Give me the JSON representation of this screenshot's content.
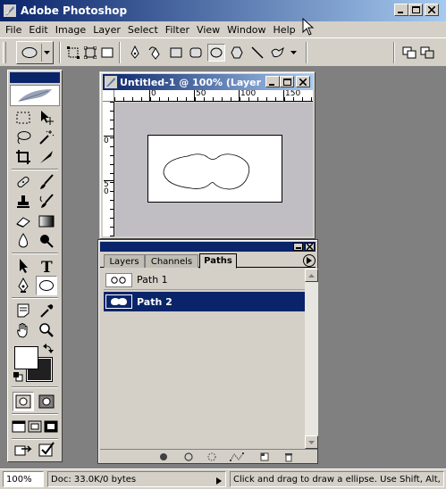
{
  "app": {
    "title": "Adobe Photoshop"
  },
  "menu": [
    "File",
    "Edit",
    "Image",
    "Layer",
    "Select",
    "Filter",
    "View",
    "Window",
    "Help"
  ],
  "document": {
    "title": "Untitled-1 @ 100% (Layer ...",
    "ruler_h": [
      "0",
      "50",
      "100",
      "150"
    ],
    "ruler_v": [
      "0",
      "5",
      "0"
    ]
  },
  "palette": {
    "tabs": [
      "Layers",
      "Channels",
      "Paths"
    ],
    "active_tab": "Paths",
    "paths": [
      {
        "name": "Path 1",
        "selected": false
      },
      {
        "name": "Path 2",
        "selected": true
      }
    ]
  },
  "status": {
    "zoom": "100%",
    "doc": "Doc: 33.0K/0 bytes",
    "hint": "Click and drag to draw a ellipse.  Use Shift, Alt, and"
  },
  "colors": {
    "titlebar_start": "#0a246a",
    "titlebar_end": "#a6caf0",
    "selection": "#0a246a",
    "chrome": "#d4d0c8",
    "workspace": "#808080"
  }
}
